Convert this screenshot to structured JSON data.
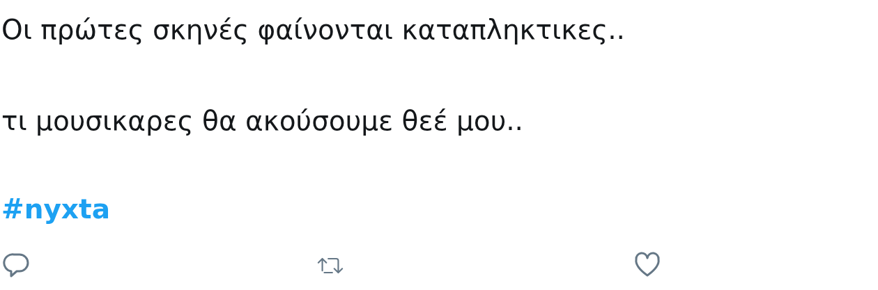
{
  "tweet": {
    "lines": [
      "Οι πρώτες σκηνές φαίνονται καταπληκτικες..",
      "τι μουσικαρες θα ακούσουμε θεέ μου.."
    ],
    "hashtag": "#nyxta",
    "actions": [
      {
        "kind": "reply"
      },
      {
        "kind": "retweet"
      },
      {
        "kind": "like"
      }
    ]
  }
}
